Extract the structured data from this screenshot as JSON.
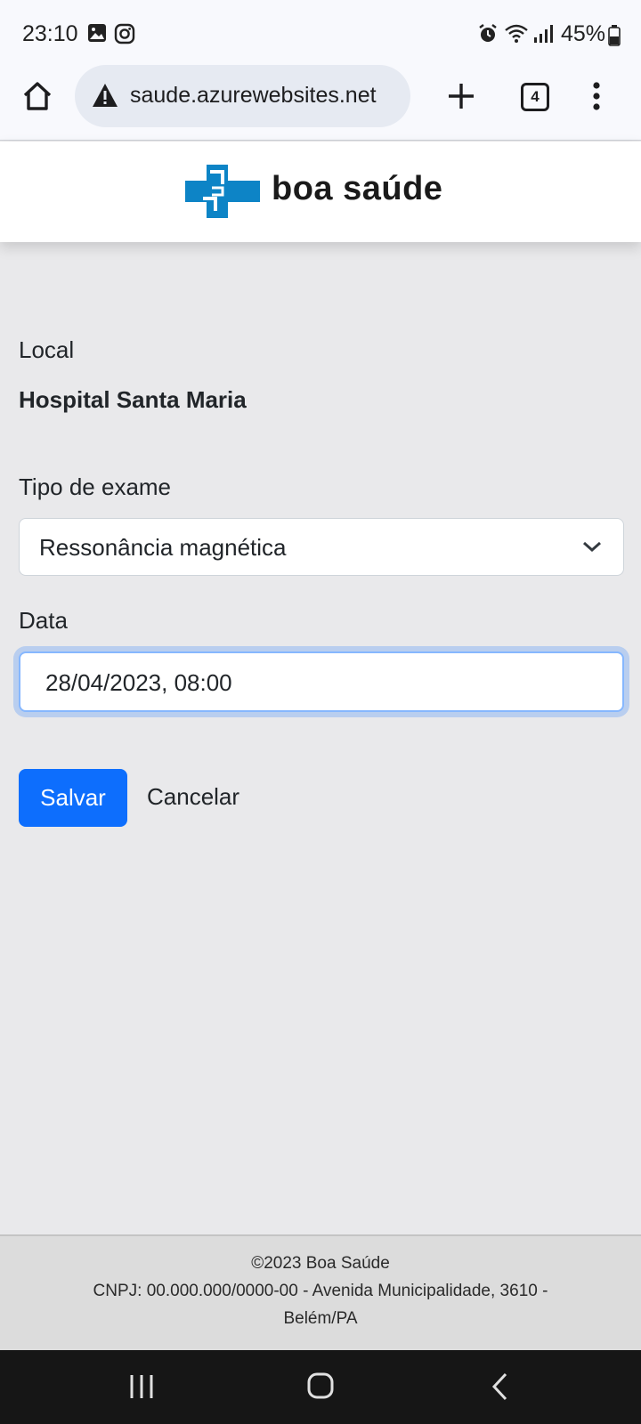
{
  "status_bar": {
    "time": "23:10",
    "battery": "45%",
    "icons": [
      "gallery-icon",
      "instagram-icon",
      "alarm-icon",
      "wifi-icon",
      "signal-icon",
      "battery-icon"
    ]
  },
  "browser": {
    "url": "saude.azurewebsites.net",
    "tab_count": "4",
    "icons": [
      "home-icon",
      "warning-icon",
      "new-tab-icon",
      "tabs-icon",
      "more-menu-icon"
    ]
  },
  "header": {
    "brand": "boa saúde",
    "logo_color": "#0d84c6"
  },
  "form": {
    "local_label": "Local",
    "local_value": "Hospital Santa Maria",
    "exam_type_label": "Tipo de exame",
    "exam_type_value": "Ressonância magnética",
    "date_label": "Data",
    "date_value": "28/04/2023, 08:00",
    "save_label": "Salvar",
    "cancel_label": "Cancelar"
  },
  "footer": {
    "copyright": "©2023 Boa Saúde",
    "address_line1": "CNPJ: 00.000.000/0000-00 - Avenida Municipalidade, 3610 -",
    "address_line2": "Belém/PA"
  },
  "colors": {
    "primary": "#0d6efd",
    "page_bg": "#e9e9eb"
  }
}
